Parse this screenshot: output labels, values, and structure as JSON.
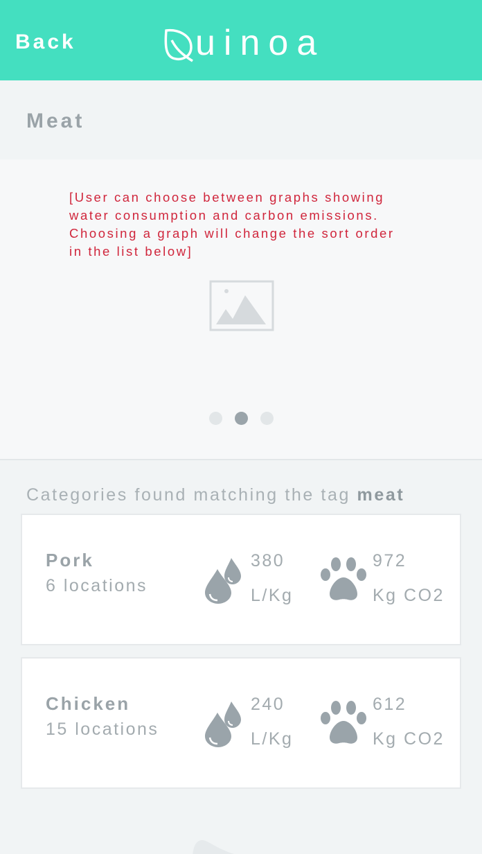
{
  "header": {
    "back_label": "Back",
    "logo_text": "uinoa",
    "background_color": "#44dfc0"
  },
  "section": {
    "title": "Meat"
  },
  "graph_panel": {
    "note": "[User can choose between graphs showing water consumption and carbon emissions. Choosing a graph will change the sort order in the list below]",
    "note_color": "#d0263c",
    "placeholder_icon": "image-placeholder-icon",
    "pager": {
      "count": 3,
      "active_index": 1
    }
  },
  "results": {
    "heading_prefix": "Categories found matching the tag",
    "heading_tag": "meat",
    "items": [
      {
        "name": "Pork",
        "locations": "6 locations",
        "water_value": "380",
        "water_unit": "L/Kg",
        "co2_value": "972",
        "co2_unit": "Kg CO2",
        "water_icon": "water-drops-icon",
        "co2_icon": "paw-print-icon"
      },
      {
        "name": "Chicken",
        "locations": "15 locations",
        "water_value": "240",
        "water_unit": "L/Kg",
        "co2_value": "612",
        "co2_unit": "Kg CO2",
        "water_icon": "water-drops-icon",
        "co2_icon": "paw-print-icon"
      }
    ]
  }
}
